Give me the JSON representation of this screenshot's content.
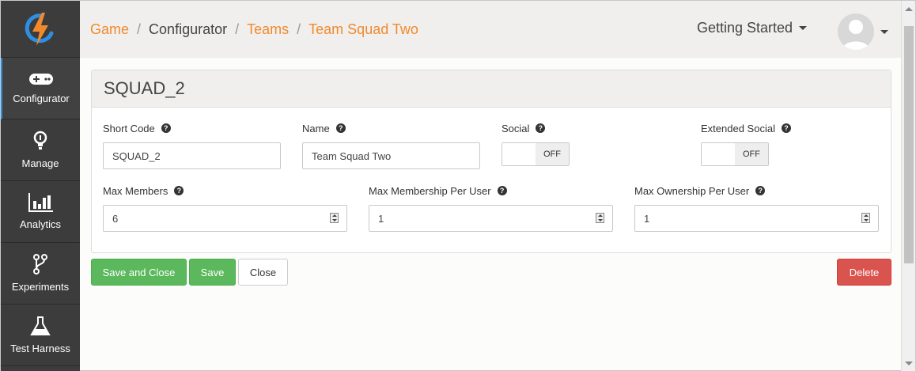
{
  "sidebar": {
    "logo_icon": "lightning-logo-icon",
    "items": [
      {
        "label": "Configurator",
        "icon": "gamepad-icon",
        "active": true
      },
      {
        "label": "Manage",
        "icon": "lightbulb-icon",
        "active": false
      },
      {
        "label": "Analytics",
        "icon": "bar-chart-icon",
        "active": false
      },
      {
        "label": "Experiments",
        "icon": "branch-icon",
        "active": false
      },
      {
        "label": "Test Harness",
        "icon": "flask-icon",
        "active": false
      }
    ]
  },
  "breadcrumb": {
    "items": [
      "Game",
      "Configurator",
      "Teams",
      "Team Squad Two"
    ],
    "separator": "/"
  },
  "header": {
    "getting_started": "Getting Started"
  },
  "panel": {
    "title": "SQUAD_2",
    "fields": {
      "short_code": {
        "label": "Short Code",
        "value": "SQUAD_2"
      },
      "name": {
        "label": "Name",
        "value": "Team Squad Two"
      },
      "social": {
        "label": "Social",
        "state": "OFF"
      },
      "extended_social": {
        "label": "Extended Social",
        "state": "OFF"
      },
      "max_members": {
        "label": "Max Members",
        "value": "6"
      },
      "max_membership": {
        "label": "Max Membership Per User",
        "value": "1"
      },
      "max_ownership": {
        "label": "Max Ownership Per User",
        "value": "1"
      }
    }
  },
  "actions": {
    "save_and_close": "Save and Close",
    "save": "Save",
    "close": "Close",
    "delete": "Delete"
  },
  "colors": {
    "accent": "#f08a2c",
    "sidebar": "#3c3c3c",
    "success": "#5cb85c",
    "danger": "#d9534f"
  }
}
